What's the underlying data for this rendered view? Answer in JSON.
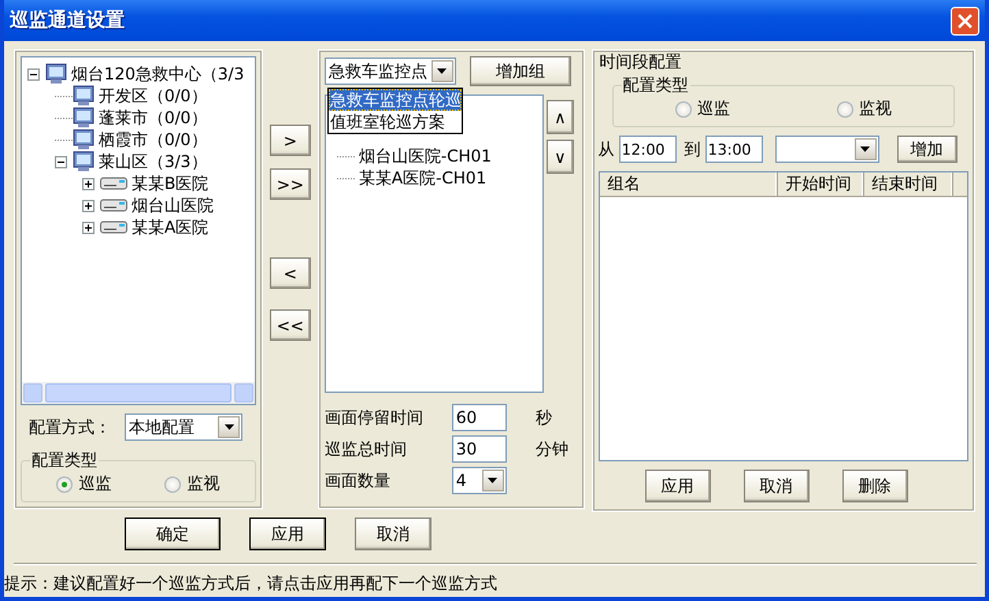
{
  "window": {
    "title": "巡监通道设置"
  },
  "source_tree": {
    "items": [
      {
        "label": "烟台120急救中心（3/3",
        "kind": "center",
        "expanded": true,
        "children": [
          {
            "label": "开发区（0/0）",
            "kind": "area"
          },
          {
            "label": "蓬莱市（0/0）",
            "kind": "area"
          },
          {
            "label": "栖霞市（0/0）",
            "kind": "area"
          },
          {
            "label": "莱山区（3/3）",
            "kind": "area",
            "expanded": true,
            "children": [
              {
                "label": "某某B医院",
                "kind": "device",
                "expanded": false
              },
              {
                "label": "烟台山医院",
                "kind": "device",
                "expanded": false
              },
              {
                "label": "某某A医院",
                "kind": "device",
                "expanded": false
              }
            ]
          }
        ]
      }
    ]
  },
  "transfer_buttons": [
    ">",
    ">>",
    "<",
    "<<"
  ],
  "config_mode": {
    "label": "配置方式：",
    "value": "本地配置"
  },
  "config_type": {
    "title": "配置类型",
    "options": [
      {
        "label": "巡监",
        "selected": true
      },
      {
        "label": "监视",
        "selected": false
      }
    ]
  },
  "group_select": {
    "value": "急救车监控点",
    "options": [
      {
        "label": "急救车监控点轮巡",
        "selected": true
      },
      {
        "label": "值班室轮巡方案",
        "selected": false
      }
    ]
  },
  "add_group_button": "增加组",
  "channel_tree": [
    "烟台山医院-CH01",
    "某某A医院-CH01"
  ],
  "order_buttons": [
    "∧",
    "∨"
  ],
  "settings": [
    {
      "label": "画面停留时间",
      "value": "60",
      "unit": "秒",
      "kind": "field"
    },
    {
      "label": "巡监总时间",
      "value": "30",
      "unit": "分钟",
      "kind": "field"
    },
    {
      "label": "画面数量",
      "value": "4",
      "kind": "select"
    }
  ],
  "time_config": {
    "title": "时间段配置",
    "config_type": {
      "title": "配置类型",
      "options": [
        {
          "label": "巡监",
          "selected": false
        },
        {
          "label": "监视",
          "selected": false
        }
      ]
    },
    "from_label": "从",
    "from": "12:00",
    "to_label": "到",
    "to": "13:00",
    "add_button": "增加",
    "table": {
      "columns": [
        "组名",
        "开始时间",
        "结束时间"
      ]
    },
    "buttons": [
      "应用",
      "取消",
      "删除"
    ]
  },
  "dialog_buttons": [
    {
      "label": "确定",
      "default": true
    },
    {
      "label": "应用",
      "default": true
    },
    {
      "label": "取消",
      "default": false
    }
  ],
  "status": "提示：建议配置好一个巡监方式后，请点击应用再配下一个巡监方式"
}
